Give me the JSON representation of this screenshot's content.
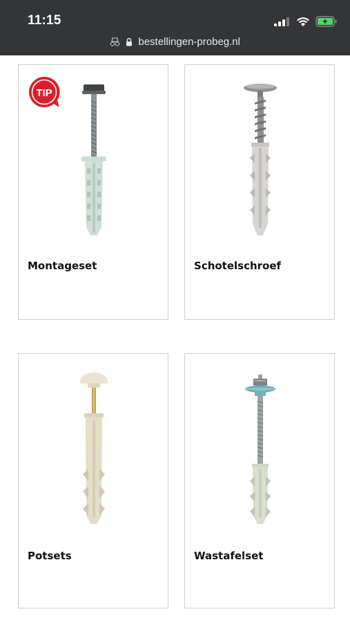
{
  "status_bar": {
    "time": "11:15"
  },
  "address_bar": {
    "url": "bestellingen-probeg.nl"
  },
  "products": [
    {
      "label": "Montageset",
      "badge": "TIP",
      "icon": "montageset-product-image"
    },
    {
      "label": "Schotelschroef",
      "icon": "schotelschroef-product-image"
    },
    {
      "label": "Potsets",
      "icon": "potsets-product-image"
    },
    {
      "label": "Wastafelset",
      "icon": "wastafelset-product-image"
    }
  ],
  "colors": {
    "topbar": "#333537",
    "tip_badge": "#d91f2a",
    "battery": "#4cd964",
    "plug_light": "#cfe0d6",
    "plug_beige": "#e6dcc8",
    "washer_blue": "#5da7b3"
  }
}
